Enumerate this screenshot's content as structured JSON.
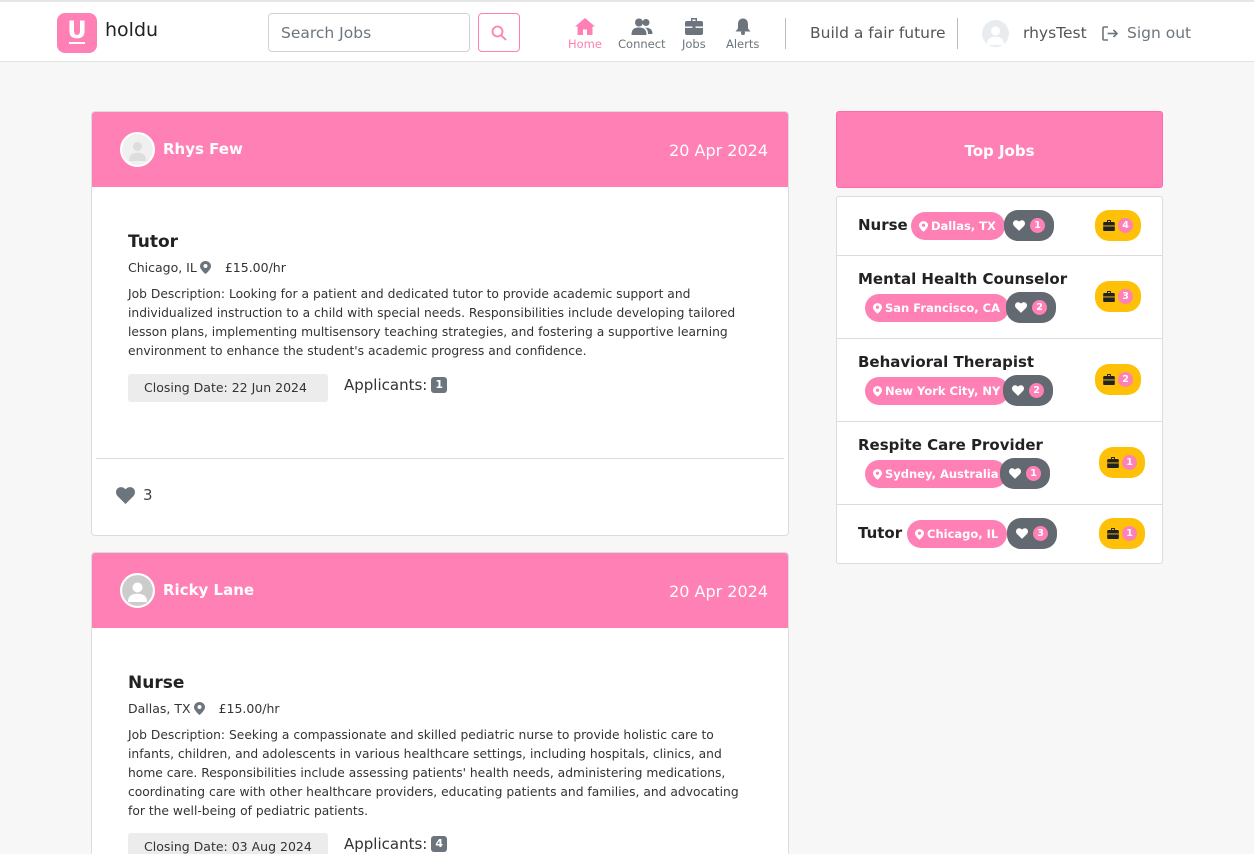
{
  "app": {
    "brand": "holdu",
    "logo_letter": "U"
  },
  "header": {
    "search_placeholder": "Search Jobs",
    "nav": [
      {
        "label": "Home",
        "icon": "home-icon",
        "active": true
      },
      {
        "label": "Connect",
        "icon": "users-icon",
        "active": false
      },
      {
        "label": "Jobs",
        "icon": "briefcase-icon",
        "active": false
      },
      {
        "label": "Alerts",
        "icon": "bell-icon",
        "active": false
      }
    ],
    "tagline": "Build a fair future",
    "username": "rhysTest",
    "signout_label": "Sign out"
  },
  "colors": {
    "brand_pink": "#ff80b5",
    "like_grey": "#626970",
    "job_yellow": "#ffc107"
  },
  "posts": [
    {
      "author": "Rhys Few",
      "date": "20 Apr 2024",
      "job_title": "Tutor",
      "location": "Chicago, IL",
      "rate": "£15.00/hr",
      "description": "Job Description: Looking for a patient and dedicated tutor to provide academic support and individualized instruction to a child with special needs. Responsibilities include developing tailored lesson plans, implementing multisensory teaching strategies, and fostering a supportive learning environment to enhance the student's academic progress and confidence.",
      "closing": "Closing Date: 22 Jun 2024",
      "applicants_label": "Applicants:",
      "applicants": "1",
      "likes": "3"
    },
    {
      "author": "Ricky Lane",
      "date": "20 Apr 2024",
      "job_title": "Nurse",
      "location": "Dallas, TX",
      "rate": "£15.00/hr",
      "description": "Job Description: Seeking a compassionate and skilled pediatric nurse to provide holistic care to infants, children, and adolescents in various healthcare settings, including hospitals, clinics, and home care. Responsibilities include assessing patients' health needs, administering medications, coordinating care with other healthcare providers, educating patients and families, and advocating for the well-being of pediatric patients.",
      "closing": "Closing Date: 03 Aug 2024",
      "applicants_label": "Applicants:",
      "applicants": "4"
    }
  ],
  "top_jobs": {
    "title": "Top Jobs",
    "items": [
      {
        "title": "Nurse",
        "location": "Dallas, TX",
        "likes": "1",
        "jobs": "4"
      },
      {
        "title": "Mental Health Counselor",
        "location": "San Francisco, CA",
        "likes": "2",
        "jobs": "3"
      },
      {
        "title": "Behavioral Therapist",
        "location": "New York City, NY",
        "likes": "2",
        "jobs": "2"
      },
      {
        "title": "Respite Care Provider",
        "location": "Sydney, Australia",
        "likes": "1",
        "jobs": "1"
      },
      {
        "title": "Tutor",
        "location": "Chicago, IL",
        "likes": "3",
        "jobs": "1"
      }
    ]
  }
}
